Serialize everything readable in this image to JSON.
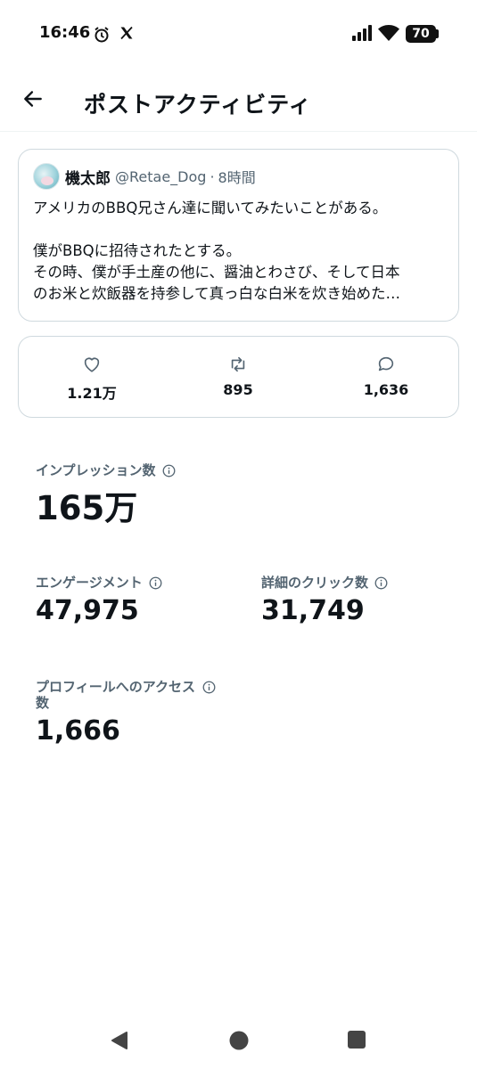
{
  "status_bar": {
    "time": "16:46",
    "battery": "70",
    "icons": [
      "alarm-icon",
      "x-logo-icon",
      "signal-icon",
      "wifi-icon",
      "battery-icon"
    ]
  },
  "header": {
    "title": "ポストアクティビティ",
    "back_icon": "arrow-left-icon"
  },
  "post": {
    "author_name": "機太郎",
    "handle": "@Retae_Dog",
    "separator": "·",
    "time": "8時間",
    "lines": [
      "アメリカのBBQ兄さん達に聞いてみたいことがある。",
      "",
      "僕がBBQに招待されたとする。",
      "その時、僕が手土産の他に、醤油とわさび、そして日本",
      "のお米と炊飯器を持参して真っ白な白米を炊き始めた…"
    ]
  },
  "engagement": {
    "likes": "1.21万",
    "reposts": "895",
    "replies": "1,636"
  },
  "metrics": {
    "impressions": {
      "label": "インプレッション数",
      "value": "165万"
    },
    "engagements": {
      "label": "エンゲージメント",
      "value": "47,975"
    },
    "detail_clicks": {
      "label": "詳細のクリック数",
      "value": "31,749"
    },
    "profile_visits": {
      "label": "プロフィールへのアクセス数",
      "value": "1,666"
    }
  },
  "colors": {
    "text_primary": "#0f1419",
    "text_secondary": "#536471",
    "border": "#cfd9de"
  }
}
